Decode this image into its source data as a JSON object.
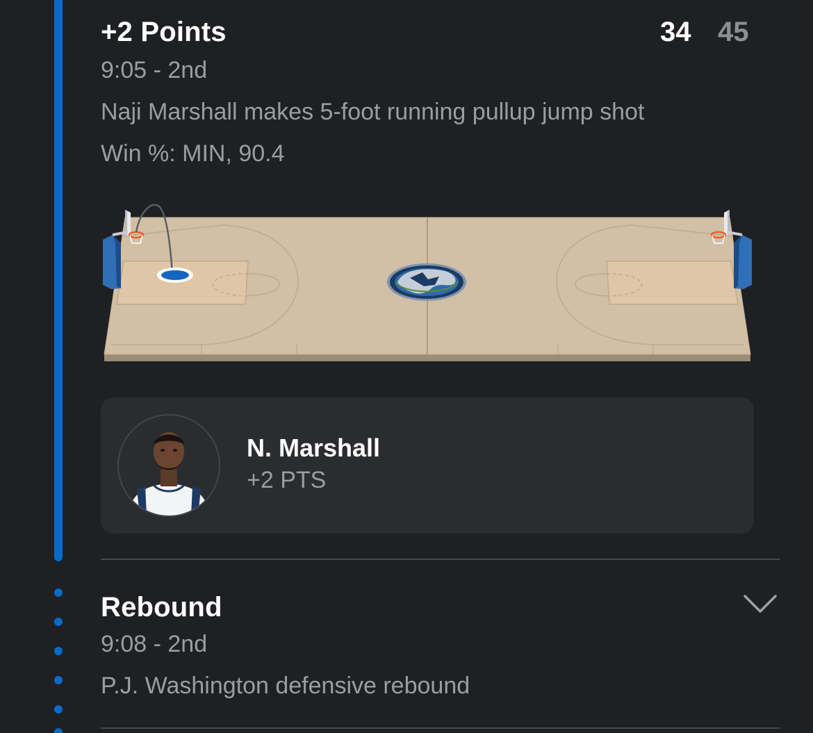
{
  "play1": {
    "title": "+2 Points",
    "score_home": "34",
    "score_away": "45",
    "time": "9:05 - 2nd",
    "description": "Naji Marshall makes 5-foot running pullup jump shot",
    "win_pct": "Win %: MIN, 90.4"
  },
  "player_card": {
    "name": "N. Marshall",
    "stat": "+2 PTS"
  },
  "play2": {
    "title": "Rebound",
    "time": "9:08 - 2nd",
    "description": "P.J. Washington defensive rebound"
  },
  "colors": {
    "accent": "#0a6ac8",
    "background": "#1f2023",
    "card": "#2b2c2f",
    "court": "#d1bfa6"
  },
  "icons": {
    "expand": "chevron-down-icon",
    "logo": "timberwolves-logo"
  }
}
